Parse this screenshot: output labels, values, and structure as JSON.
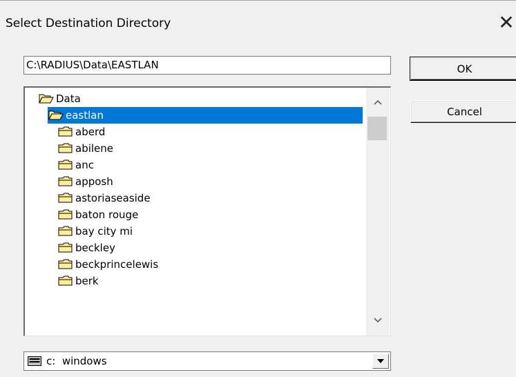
{
  "window": {
    "title": "Select Destination Directory",
    "close_glyph": "✕"
  },
  "path": {
    "value": "C:\\RADIUS\\Data\\EASTLAN"
  },
  "buttons": {
    "ok": "OK",
    "cancel": "Cancel"
  },
  "tree": {
    "items": [
      {
        "label": "Data",
        "open": true,
        "selected": false
      },
      {
        "label": "eastlan",
        "open": true,
        "selected": true
      },
      {
        "label": "aberd",
        "open": false,
        "selected": false
      },
      {
        "label": "abilene",
        "open": false,
        "selected": false
      },
      {
        "label": "anc",
        "open": false,
        "selected": false
      },
      {
        "label": "apposh",
        "open": false,
        "selected": false
      },
      {
        "label": "astoriaseaside",
        "open": false,
        "selected": false
      },
      {
        "label": "baton rouge",
        "open": false,
        "selected": false
      },
      {
        "label": "bay city mi",
        "open": false,
        "selected": false
      },
      {
        "label": "beckley",
        "open": false,
        "selected": false
      },
      {
        "label": "beckprincelewis",
        "open": false,
        "selected": false
      },
      {
        "label": "berk",
        "open": false,
        "selected": false
      }
    ]
  },
  "drive": {
    "label": "c:  windows",
    "icon": "drive-icon"
  },
  "colors": {
    "selection": "#0078d7",
    "folder": "#ffef9b",
    "folder_outline": "#000000"
  }
}
